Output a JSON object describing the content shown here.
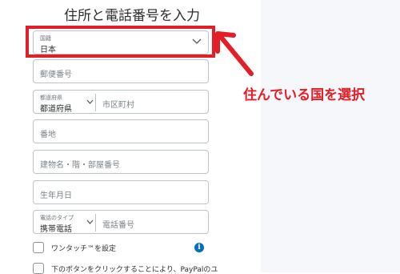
{
  "form": {
    "title": "住所と電話番号を入力",
    "country": {
      "label": "国籍",
      "value": "日本"
    },
    "postal_placeholder": "郵便番号",
    "prefecture": {
      "label": "都道府県",
      "value": "都道府県"
    },
    "city_placeholder": "市区町村",
    "street_placeholder": "番地",
    "building_placeholder": "建物名・階・部屋番号",
    "birthdate_placeholder": "生年月日",
    "phone_type": {
      "label": "電話のタイプ",
      "value": "携帯電話"
    },
    "phone_placeholder": "電話番号",
    "one_touch_label": "ワンタッチ™を設定",
    "terms_label": "下のボタンをクリックすることにより、PayPalのユ"
  },
  "annotation": {
    "text": "住んでいる国を選択",
    "color": "#e41e26"
  },
  "icons": {
    "chevron": "chevron-down-icon",
    "info": "info-icon",
    "arrow": "arrow-icon"
  },
  "colors": {
    "accent": "#e41e26",
    "info_blue": "#0070ba",
    "border": "#b9c4c9",
    "side_panel": "#f5f7fa"
  }
}
